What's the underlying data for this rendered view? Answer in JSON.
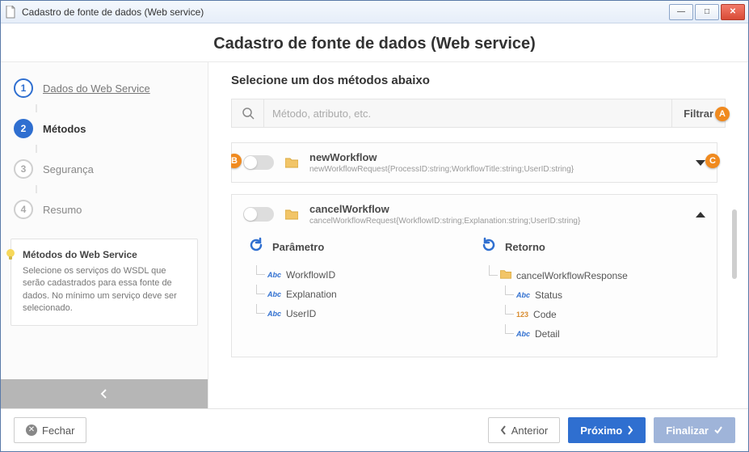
{
  "window": {
    "title": "Cadastro de fonte de dados (Web service)"
  },
  "page": {
    "title": "Cadastro de fonte de dados (Web service)"
  },
  "sidebar": {
    "steps": [
      {
        "num": "1",
        "label": "Dados do Web Service",
        "state": "done"
      },
      {
        "num": "2",
        "label": "Métodos",
        "state": "active"
      },
      {
        "num": "3",
        "label": "Segurança",
        "state": "todo"
      },
      {
        "num": "4",
        "label": "Resumo",
        "state": "todo"
      }
    ],
    "info": {
      "title": "Métodos do Web Service",
      "text": "Selecione os serviços do WSDL que serão cadastrados para essa fonte de dados. No mínimo um serviço deve ser selecionado."
    }
  },
  "main": {
    "section_title": "Selecione um dos métodos abaixo",
    "search": {
      "placeholder": "Método, atributo, etc.",
      "value": ""
    },
    "filter_label": "Filtrar",
    "methods": [
      {
        "name": "newWorkflow",
        "signature": "newWorkflowRequest{ProcessID:string;WorkflowTitle:string;UserID:string}",
        "enabled": false,
        "expanded": false
      },
      {
        "name": "cancelWorkflow",
        "signature": "cancelWorkflowRequest{WorkflowID:string;Explanation:string;UserID:string}",
        "enabled": false,
        "expanded": true,
        "param_title": "Parâmetro",
        "return_title": "Retorno",
        "params": [
          {
            "type": "Abc",
            "name": "WorkflowID"
          },
          {
            "type": "Abc",
            "name": "Explanation"
          },
          {
            "type": "Abc",
            "name": "UserID"
          }
        ],
        "returns": {
          "root": "cancelWorkflowResponse",
          "children": [
            {
              "type": "Abc",
              "name": "Status"
            },
            {
              "type": "123",
              "name": "Code"
            },
            {
              "type": "Abc",
              "name": "Detail"
            }
          ]
        }
      }
    ]
  },
  "badges": {
    "a": "A",
    "b": "B",
    "c": "C"
  },
  "footer": {
    "close": "Fechar",
    "prev": "Anterior",
    "next": "Próximo",
    "finish": "Finalizar"
  }
}
